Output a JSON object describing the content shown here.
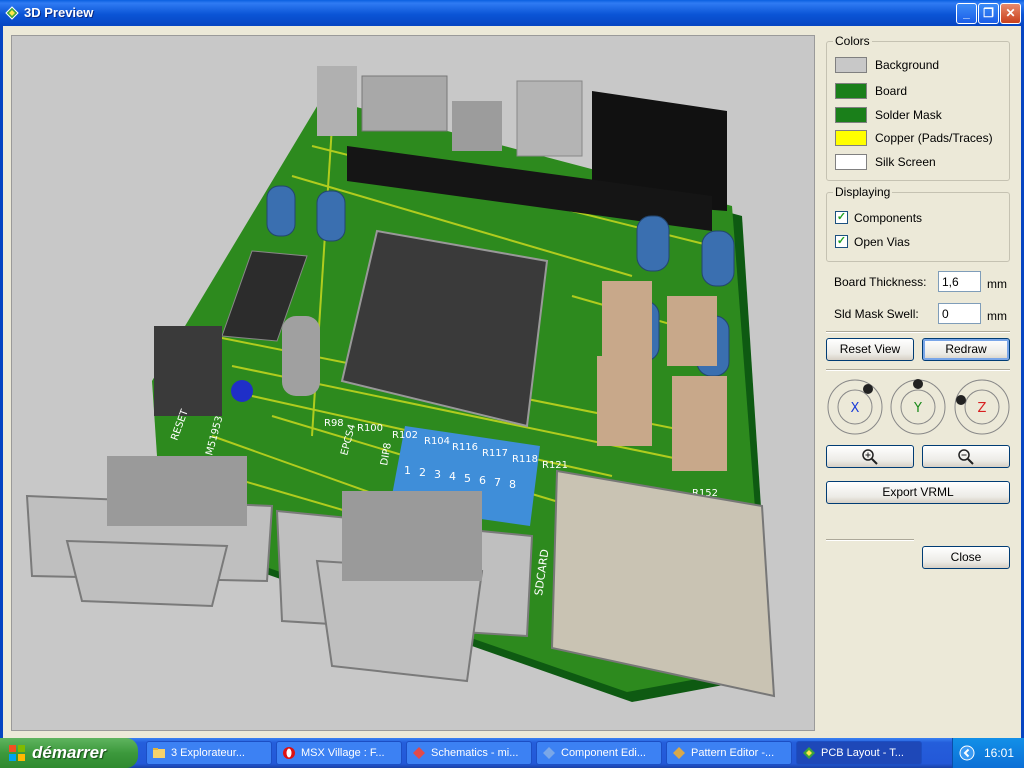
{
  "window": {
    "title": "3D Preview"
  },
  "colors_group": {
    "legend": "Colors",
    "items": [
      {
        "label": "Background",
        "color": "#c8c8c8"
      },
      {
        "label": "Board",
        "color": "#1a7f1a"
      },
      {
        "label": "Solder Mask",
        "color": "#1a7f1a"
      },
      {
        "label": "Copper (Pads/Traces)",
        "color": "#ffff00"
      },
      {
        "label": "Silk Screen",
        "color": "#ffffff"
      }
    ]
  },
  "displaying_group": {
    "legend": "Displaying",
    "items": [
      {
        "label": "Components",
        "checked": true
      },
      {
        "label": "Open Vias",
        "checked": true
      }
    ]
  },
  "board_thickness": {
    "label": "Board Thickness:",
    "value": "1,6",
    "unit": "mm"
  },
  "sld_mask_swell": {
    "label": "Sld Mask Swell:",
    "value": "0",
    "unit": "mm"
  },
  "buttons": {
    "reset_view": "Reset View",
    "redraw": "Redraw",
    "export_vrml": "Export VRML",
    "close": "Close"
  },
  "axes": [
    {
      "label": "X",
      "color": "#1a3cd8"
    },
    {
      "label": "Y",
      "color": "#1a8a1a"
    },
    {
      "label": "Z",
      "color": "#d82020"
    }
  ],
  "pcb_labels": {
    "dip_numbers": [
      "1",
      "2",
      "3",
      "4",
      "5",
      "6",
      "7",
      "8"
    ],
    "sdcard": "SDCARD",
    "dip8": "DIP8",
    "reset": "RESET",
    "chip1": "EPCS4",
    "chip2": "M51953",
    "r_labels": [
      "R98",
      "R100",
      "R102",
      "R104",
      "R116",
      "R117",
      "R118",
      "R121",
      "R152"
    ]
  },
  "taskbar": {
    "start_label": "démarrer",
    "tasks": [
      {
        "label": "3 Explorateur...",
        "icon": "folder-icon",
        "active": false
      },
      {
        "label": "MSX Village : F...",
        "icon": "opera-icon",
        "active": false
      },
      {
        "label": "Schematics - mi...",
        "icon": "schematics-icon",
        "active": false
      },
      {
        "label": "Component Edi...",
        "icon": "component-icon",
        "active": false
      },
      {
        "label": "Pattern Editor -...",
        "icon": "pattern-icon",
        "active": false
      },
      {
        "label": "PCB Layout - T...",
        "icon": "pcb-icon",
        "active": true
      }
    ],
    "clock": "16:01"
  }
}
